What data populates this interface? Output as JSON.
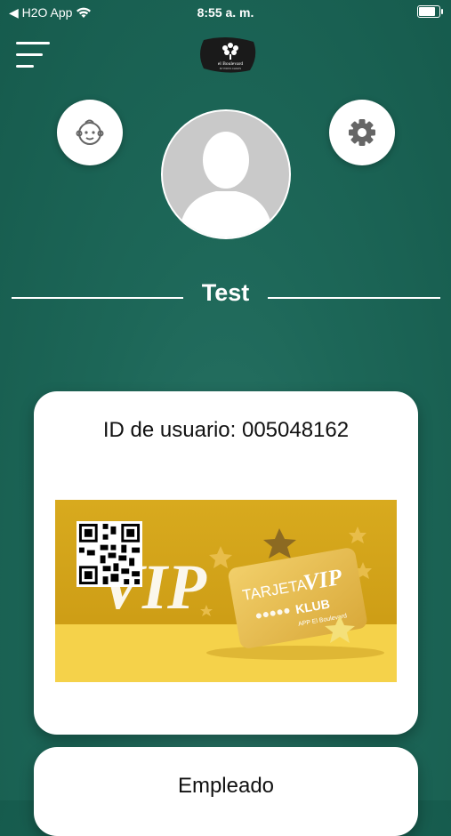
{
  "status_bar": {
    "back_app": "◀ H2O App",
    "time": "8:55 a. m.",
    "battery_level": 0.9
  },
  "header": {
    "menu_icon": "hamburger-menu-icon",
    "logo": {
      "brand": "el Boulevard",
      "tagline": "BY PIRITA CHAVIS"
    }
  },
  "profile": {
    "left_icon": "baby-face-icon",
    "right_icon": "gear-icon",
    "avatar_icon": "default-user-avatar",
    "name": "Test"
  },
  "id_card": {
    "id_label": "ID de usuario: 005048162",
    "banner": {
      "vip_text": "VIP",
      "card_title_small": "TARJETA",
      "card_title_big": "VIP",
      "card_brand": "KLUB",
      "card_footer": "APP El Boulevard"
    }
  },
  "employee_card": {
    "label": "Empleado"
  },
  "colors": {
    "background": "#1d6758",
    "card": "#ffffff",
    "banner_gold_top": "#d7a91c",
    "banner_gold_bottom": "#f6d24a",
    "avatar_gray": "#c9c9c9"
  }
}
